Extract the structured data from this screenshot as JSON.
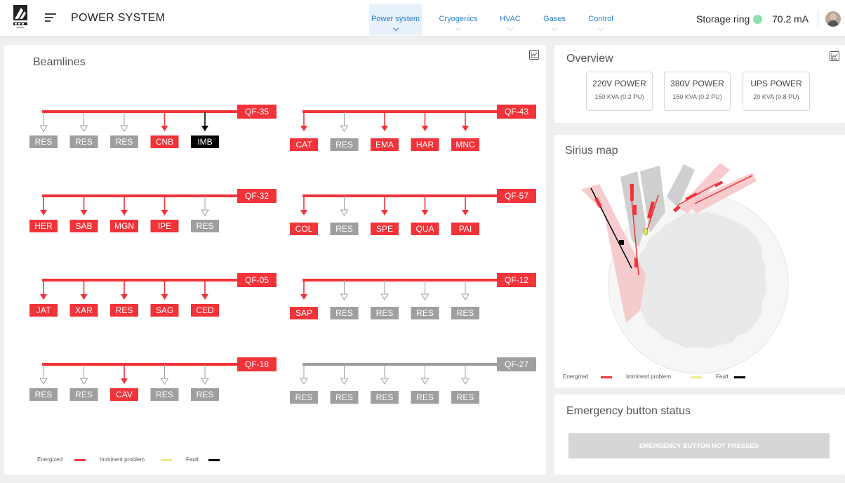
{
  "header": {
    "title": "POWER SYSTEM",
    "tabs": [
      {
        "label": "Power system",
        "active": true
      },
      {
        "label": "Cryogenics",
        "active": false
      },
      {
        "label": "HVAC",
        "active": false
      },
      {
        "label": "Gases",
        "active": false
      },
      {
        "label": "Control",
        "active": false
      }
    ],
    "storage_ring": {
      "label": "Storage ring",
      "value": "70.2 mA",
      "status_color": "#8ce0a8"
    }
  },
  "colors": {
    "energized": "#f2333a",
    "imminent": "#ecec8a",
    "fault": "#000000",
    "inactive": "#9f9f9f",
    "accent": "#2b7fd6"
  },
  "beamlines": {
    "title": "Beamlines",
    "groups": [
      {
        "breaker": "QF-35",
        "state": "energized",
        "loads": [
          {
            "name": "RES",
            "state": "off"
          },
          {
            "name": "RES",
            "state": "off"
          },
          {
            "name": "RES",
            "state": "off"
          },
          {
            "name": "CNB",
            "state": "energized"
          },
          {
            "name": "IMB",
            "state": "fault"
          }
        ]
      },
      {
        "breaker": "QF-43",
        "state": "energized",
        "loads": [
          {
            "name": "CAT",
            "state": "energized"
          },
          {
            "name": "RES",
            "state": "off"
          },
          {
            "name": "EMA",
            "state": "energized"
          },
          {
            "name": "HAR",
            "state": "energized"
          },
          {
            "name": "MNC",
            "state": "energized"
          }
        ]
      },
      {
        "breaker": "QF-32",
        "state": "energized",
        "loads": [
          {
            "name": "HER",
            "state": "energized"
          },
          {
            "name": "SAB",
            "state": "energized"
          },
          {
            "name": "MGN",
            "state": "energized"
          },
          {
            "name": "IPE",
            "state": "energized"
          },
          {
            "name": "RES",
            "state": "off"
          }
        ]
      },
      {
        "breaker": "QF-57",
        "state": "energized",
        "loads": [
          {
            "name": "COL",
            "state": "energized"
          },
          {
            "name": "RES",
            "state": "off"
          },
          {
            "name": "SPE",
            "state": "energized"
          },
          {
            "name": "QUA",
            "state": "energized"
          },
          {
            "name": "PAI",
            "state": "energized"
          }
        ]
      },
      {
        "breaker": "QF-05",
        "state": "energized",
        "loads": [
          {
            "name": "JAT",
            "state": "energized"
          },
          {
            "name": "XAR",
            "state": "energized"
          },
          {
            "name": "RES",
            "state": "energized"
          },
          {
            "name": "SAG",
            "state": "energized"
          },
          {
            "name": "CED",
            "state": "energized"
          }
        ]
      },
      {
        "breaker": "QF-12",
        "state": "energized",
        "loads": [
          {
            "name": "SAP",
            "state": "energized"
          },
          {
            "name": "RES",
            "state": "off"
          },
          {
            "name": "RES",
            "state": "off"
          },
          {
            "name": "RES",
            "state": "off"
          },
          {
            "name": "RES",
            "state": "off"
          }
        ]
      },
      {
        "breaker": "QF-18",
        "state": "energized",
        "loads": [
          {
            "name": "RES",
            "state": "off"
          },
          {
            "name": "RES",
            "state": "off"
          },
          {
            "name": "CAV",
            "state": "energized"
          },
          {
            "name": "RES",
            "state": "off"
          },
          {
            "name": "RES",
            "state": "off"
          }
        ]
      },
      {
        "breaker": "QF-27",
        "state": "off",
        "loads": [
          {
            "name": "RES",
            "state": "off"
          },
          {
            "name": "RES",
            "state": "off"
          },
          {
            "name": "RES",
            "state": "off"
          },
          {
            "name": "RES",
            "state": "off"
          },
          {
            "name": "RES",
            "state": "off"
          }
        ]
      }
    ],
    "legend": {
      "energized": "Energized",
      "imminent": "Imminent problem",
      "fault": "Fault"
    }
  },
  "overview": {
    "title": "Overview",
    "cards": [
      {
        "title": "220V POWER",
        "subtitle": "150 KVA (0.2 PU)"
      },
      {
        "title": "380V POWER",
        "subtitle": "150 KVA (0.2 PU)"
      },
      {
        "title": "UPS POWER",
        "subtitle": "20 KVA (0.8 PU)"
      }
    ]
  },
  "sirius": {
    "title": "Sirius map",
    "legend": {
      "energized": "Energized",
      "imminent": "Imminent problem",
      "fault": "Fault"
    }
  },
  "emergency": {
    "title": "Emergency button status",
    "button_label": "EMERGENCY BUTTON NOT PRESSED"
  }
}
